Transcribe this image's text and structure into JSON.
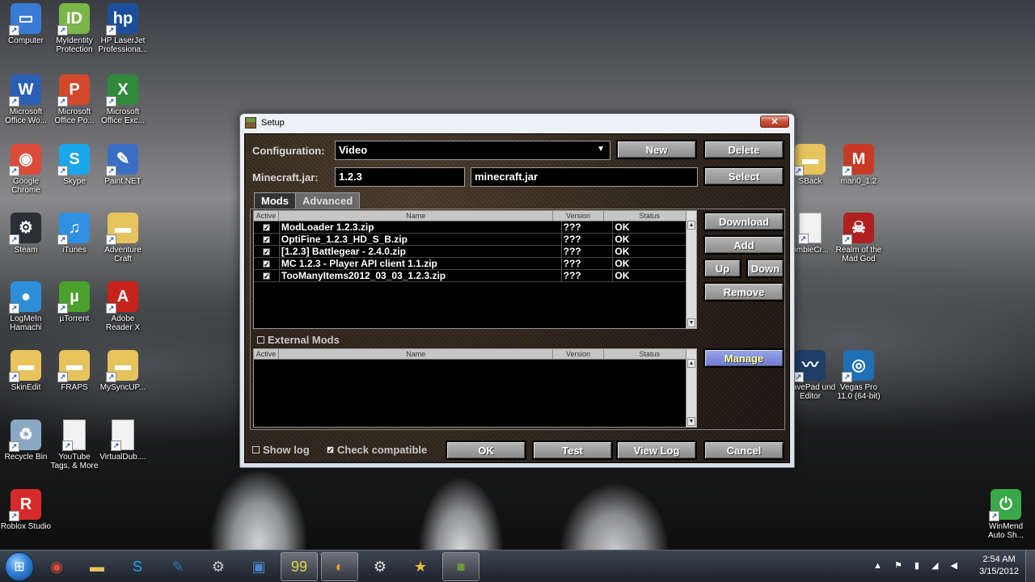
{
  "desktop": {
    "icons": [
      {
        "label": "Computer",
        "icon": "computer-icon",
        "color": "#3a7bd5",
        "glyph": "▭"
      },
      {
        "label": "MyIdentity Protection",
        "icon": "identity-shield-icon",
        "color": "#7ab648",
        "glyph": "ID"
      },
      {
        "label": "HP LaserJet Professiona...",
        "icon": "printer-icon",
        "color": "#1b4f9c",
        "glyph": "hp"
      },
      {
        "label": "Microsoft Office Wo...",
        "icon": "word-icon",
        "color": "#2b5fb4",
        "glyph": "W"
      },
      {
        "label": "Microsoft Office Po...",
        "icon": "powerpoint-icon",
        "color": "#d2482a",
        "glyph": "P"
      },
      {
        "label": "Microsoft Office Exc...",
        "icon": "excel-icon",
        "color": "#2f8a3b",
        "glyph": "X"
      },
      {
        "label": "Google Chrome",
        "icon": "chrome-icon",
        "color": "#dd4b39",
        "glyph": "◉"
      },
      {
        "label": "Skype",
        "icon": "skype-icon",
        "color": "#1aa7ec",
        "glyph": "S"
      },
      {
        "label": "Paint.NET",
        "icon": "paint-icon",
        "color": "#3b6fc4",
        "glyph": "✎"
      },
      {
        "label": "Steam",
        "icon": "steam-icon",
        "color": "#2a2f36",
        "glyph": "⚙"
      },
      {
        "label": "iTunes",
        "icon": "itunes-icon",
        "color": "#2f8fe0",
        "glyph": "♫"
      },
      {
        "label": "Adventure Craft",
        "icon": "folder-icon",
        "color": "#e6c35c",
        "glyph": "▬"
      },
      {
        "label": "LogMeIn Hamachi",
        "icon": "hamachi-icon",
        "color": "#2e8fd8",
        "glyph": "●"
      },
      {
        "label": "µTorrent",
        "icon": "utorrent-icon",
        "color": "#4aa02c",
        "glyph": "µ"
      },
      {
        "label": "Adobe Reader X",
        "icon": "adobe-reader-icon",
        "color": "#c7221c",
        "glyph": "A"
      },
      {
        "label": "SkinEdit",
        "icon": "folder-icon",
        "color": "#e6c35c",
        "glyph": "▬"
      },
      {
        "label": "FRAPS",
        "icon": "folder-icon",
        "color": "#e6c35c",
        "glyph": "▬"
      },
      {
        "label": "MySyncUP...",
        "icon": "folder-icon",
        "color": "#e6c35c",
        "glyph": "▬"
      },
      {
        "label": "Recycle Bin",
        "icon": "recycle-bin-icon",
        "color": "#8aa7c4",
        "glyph": "♻"
      },
      {
        "label": "YouTube Tags, & More",
        "icon": "document-icon",
        "color": "#f2f2f2",
        "glyph": ""
      },
      {
        "label": "VirtualDub....",
        "icon": "document-icon",
        "color": "#f2f2f2",
        "glyph": ""
      },
      {
        "label": "Roblox Studio",
        "icon": "roblox-icon",
        "color": "#d72b2b",
        "glyph": "R"
      },
      {
        "label": "SBack",
        "icon": "folder-icon",
        "color": "#e6c35c",
        "glyph": "▬"
      },
      {
        "label": "mari0_1.2",
        "icon": "mario-icon",
        "color": "#c83a26",
        "glyph": "M"
      },
      {
        "label": "ombieCr...",
        "icon": "document-icon",
        "color": "#f2f2f2",
        "glyph": ""
      },
      {
        "label": "Realm of the Mad God",
        "icon": "realm-icon",
        "color": "#b02020",
        "glyph": "☠"
      },
      {
        "label": "WavePad und Editor",
        "icon": "wavepad-icon",
        "color": "#1e3e66",
        "glyph": "〰"
      },
      {
        "label": "Vegas Pro 11.0 (64-bit)",
        "icon": "vegas-icon",
        "color": "#1f6fb5",
        "glyph": "◎"
      },
      {
        "label": "WinMend Auto Sh...",
        "icon": "winmend-icon",
        "color": "#3aa84a",
        "glyph": "⏻"
      }
    ]
  },
  "window": {
    "title": "Setup",
    "close_glyph": "✕",
    "configuration_label": "Configuration:",
    "configuration_value": "Video",
    "new_label": "New",
    "delete_label": "Delete",
    "jar_label": "Minecraft.jar:",
    "version_value": "1.2.3",
    "jar_value": "minecraft.jar",
    "select_label": "Select",
    "tabs": [
      "Mods",
      "Advanced"
    ],
    "columns": [
      "Active",
      "Name",
      "Version",
      "Status"
    ],
    "mods": [
      {
        "active": true,
        "name": "ModLoader 1.2.3.zip",
        "version": "???",
        "status": "OK"
      },
      {
        "active": true,
        "name": "OptiFine_1.2.3_HD_S_B.zip",
        "version": "???",
        "status": "OK"
      },
      {
        "active": true,
        "name": "[1.2.3] Battlegear - 2.4.0.zip",
        "version": "???",
        "status": "OK"
      },
      {
        "active": true,
        "name": "MC 1.2.3 - Player API client 1.1.zip",
        "version": "???",
        "status": "OK"
      },
      {
        "active": true,
        "name": "TooManyItems2012_03_03_1.2.3.zip",
        "version": "???",
        "status": "OK"
      }
    ],
    "download_label": "Download",
    "add_label": "Add",
    "up_label": "Up",
    "down_label": "Down",
    "remove_label": "Remove",
    "external_mods_label": "External Mods",
    "manage_label": "Manage",
    "show_log_label": "Show log",
    "check_compatible_label": "Check compatible",
    "ok_label": "OK",
    "test_label": "Test",
    "view_log_label": "View Log",
    "cancel_label": "Cancel"
  },
  "taskbar": {
    "pinned": [
      {
        "icon": "chrome-icon",
        "glyph": "◉",
        "color": "#dd4b39",
        "open": false
      },
      {
        "icon": "explorer-folder-icon",
        "glyph": "▬",
        "color": "#e6c35c",
        "open": false
      },
      {
        "icon": "skype-icon",
        "glyph": "S",
        "color": "#1aa7ec",
        "open": false
      },
      {
        "icon": "paint-icon",
        "glyph": "✎",
        "color": "#3b6fc4",
        "open": false
      },
      {
        "icon": "steam-icon",
        "glyph": "⚙",
        "color": "#c8c8c8",
        "open": false
      },
      {
        "icon": "teamviewer-icon",
        "glyph": "▣",
        "color": "#4a86c8",
        "open": false
      },
      {
        "icon": "fraps-icon",
        "glyph": "99",
        "color": "#e6d24a",
        "open": true
      },
      {
        "icon": "audio-icon",
        "glyph": "◐",
        "color": "#f0a020",
        "open": true
      },
      {
        "icon": "settings-icon",
        "glyph": "⚙",
        "color": "#e0e0e0",
        "open": false
      },
      {
        "icon": "vegas-star-icon",
        "glyph": "★",
        "color": "#e8c030",
        "open": false
      },
      {
        "icon": "minecraft-icon",
        "glyph": "■",
        "color": "#6b9a3a",
        "open": true
      }
    ],
    "tray_glyphs": "▲ ⚑ ▮ ◢ ◀",
    "time": "2:54 AM",
    "date": "3/15/2012"
  }
}
